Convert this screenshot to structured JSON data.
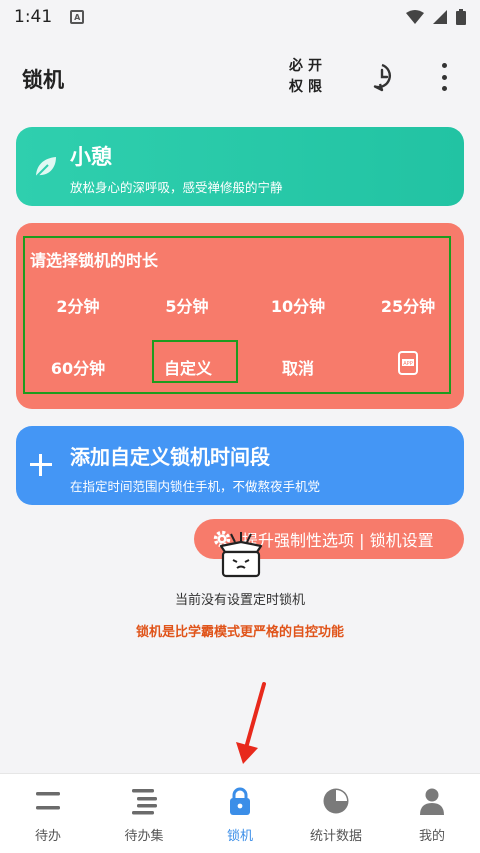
{
  "status_bar": {
    "time": "1:41",
    "notification_icon": "A"
  },
  "app_bar": {
    "title": "锁机",
    "permission_label": "必开权限",
    "history_icon": "history-icon",
    "more_icon": "more-vert-icon"
  },
  "rest_card": {
    "title": "小憩",
    "subtitle": "放松身心的深呼吸，感受禅修般的宁静",
    "color": "#22c3a3"
  },
  "lock_card": {
    "title": "请选择锁机的时长",
    "options": [
      "2分钟",
      "5分钟",
      "10分钟",
      "25分钟",
      "60分钟",
      "自定义",
      "取消"
    ],
    "app_icon_label": "APP",
    "color": "#f77b6b"
  },
  "add_card": {
    "title": "添加自定义锁机时间段",
    "subtitle": "在指定时间范围内锁住手机，不做熬夜手机党",
    "color": "#4496f5"
  },
  "settings_pill": {
    "label": "提升强制性选项 | 锁机设置"
  },
  "empty_state": {
    "message": "当前没有设置定时锁机",
    "warning": "锁机是比学霸模式更严格的自控功能"
  },
  "bottom_nav": {
    "items": [
      {
        "label": "待办",
        "icon": "todo-icon"
      },
      {
        "label": "待办集",
        "icon": "todo-set-icon"
      },
      {
        "label": "锁机",
        "icon": "lock-icon",
        "active": true
      },
      {
        "label": "统计数据",
        "icon": "pie-chart-icon"
      },
      {
        "label": "我的",
        "icon": "person-icon"
      }
    ],
    "active_color": "#3b8ee8"
  }
}
